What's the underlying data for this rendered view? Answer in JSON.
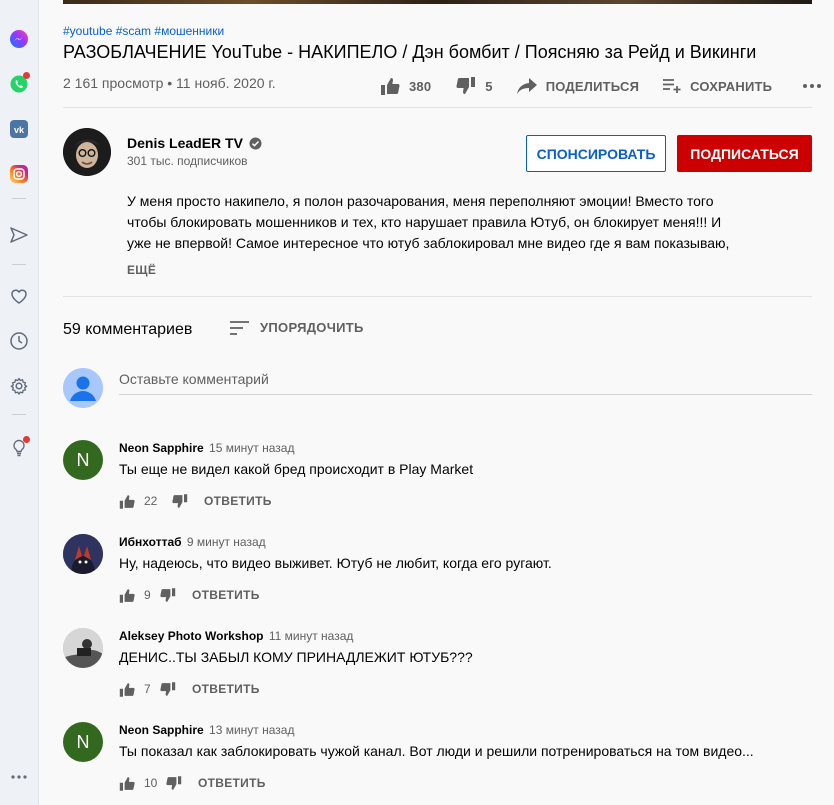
{
  "video": {
    "hashtags": "#youtube #scam #мошенники",
    "title": "РАЗОБЛАЧЕНИЕ YouTube - НАКИПЕЛО / Дэн бомбит / Поясняю за Рейд и Викинги",
    "stats": "2 161 просмотр • 11 нояб. 2020 г.",
    "likes": "380",
    "dislikes": "5",
    "share_label": "ПОДЕЛИТЬСЯ",
    "save_label": "СОХРАНИТЬ"
  },
  "channel": {
    "name": "Denis LeadER TV",
    "subscribers": "301 тыс. подписчиков",
    "sponsor_label": "СПОНСИРОВАТЬ",
    "subscribe_label": "ПОДПИСАТЬСЯ"
  },
  "description": {
    "lines": [
      "У меня просто накипело, я полон разочарования, меня переполняют эмоции! Вместо того",
      "чтобы блокировать мошенников и тех, кто нарушает правила Ютуб, он блокирует меня!!! И",
      "уже не впервой! Самое интересное что ютуб заблокировал мне видео где я вам показываю,"
    ],
    "more_label": "ЕЩЁ"
  },
  "comments": {
    "count_label": "59 комментариев",
    "sort_label": "УПОРЯДОЧИТЬ",
    "placeholder": "Оставьте комментарий",
    "reply_label": "ОТВЕТИТЬ",
    "items": [
      {
        "author": "Neon Sapphire",
        "time": "15 минут назад",
        "text": "Ты еще не видел какой бред происходит в Play Market",
        "likes": "22",
        "avatar_letter": "N",
        "avatar_color": "#33691e"
      },
      {
        "author": "Ибнхоттаб",
        "time": "9 минут назад",
        "text": "Ну, надеюсь, что видео выживет. Ютуб не любит, когда его ругают.",
        "likes": "9",
        "avatar_letter": "",
        "avatar_color": "#3b3f6b"
      },
      {
        "author": "Aleksey Photo Workshop",
        "time": "11 минут назад",
        "text": "ДЕНИС..ТЫ ЗАБЫЛ КОМУ ПРИНАДЛЕЖИТ ЮТУБ???",
        "likes": "7",
        "avatar_letter": "",
        "avatar_color": "#9e9e9e"
      },
      {
        "author": "Neon Sapphire",
        "time": "13 минут назад",
        "text": "Ты показал как заблокировать чужой канал. Вот люди и решили потренироваться на том видео...",
        "likes": "10",
        "avatar_letter": "N",
        "avatar_color": "#33691e"
      }
    ]
  },
  "sidebar": {
    "icons": [
      "messenger-icon",
      "whatsapp-icon",
      "vk-icon",
      "instagram-icon",
      "send-icon",
      "heart-icon",
      "clock-icon",
      "gear-icon",
      "lightbulb-icon",
      "more-icon"
    ]
  }
}
